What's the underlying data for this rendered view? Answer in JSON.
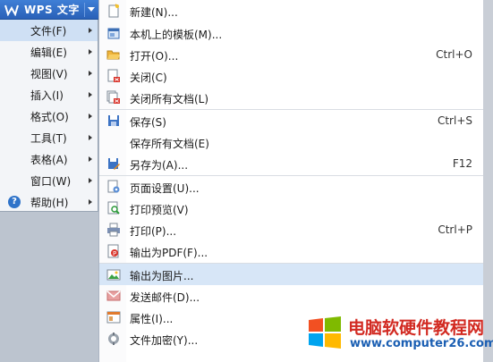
{
  "app": {
    "title": "WPS 文字"
  },
  "main_menu": {
    "items": [
      {
        "label": "文件(F)",
        "has_arrow": true
      },
      {
        "label": "编辑(E)",
        "has_arrow": true
      },
      {
        "label": "视图(V)",
        "has_arrow": true
      },
      {
        "label": "插入(I)",
        "has_arrow": true
      },
      {
        "label": "格式(O)",
        "has_arrow": true
      },
      {
        "label": "工具(T)",
        "has_arrow": true
      },
      {
        "label": "表格(A)",
        "has_arrow": true
      },
      {
        "label": "窗口(W)",
        "has_arrow": true
      },
      {
        "label": "帮助(H)",
        "has_arrow": true,
        "icon": "help-icon"
      }
    ]
  },
  "file_menu": {
    "items": [
      {
        "label": "新建(N)...",
        "icon": "new-document-icon",
        "shortcut": ""
      },
      {
        "label": "本机上的模板(M)...",
        "icon": "template-icon",
        "shortcut": ""
      },
      {
        "label": "打开(O)...",
        "icon": "open-folder-icon",
        "shortcut": "Ctrl+O"
      },
      {
        "label": "关闭(C)",
        "icon": "close-document-icon",
        "shortcut": ""
      },
      {
        "label": "关闭所有文档(L)",
        "icon": "close-all-icon",
        "shortcut": ""
      },
      {
        "label": "保存(S)",
        "icon": "save-icon",
        "shortcut": "Ctrl+S"
      },
      {
        "label": "保存所有文档(E)",
        "icon": "",
        "shortcut": ""
      },
      {
        "label": "另存为(A)...",
        "icon": "save-as-icon",
        "shortcut": "F12"
      },
      {
        "label": "页面设置(U)...",
        "icon": "page-setup-icon",
        "shortcut": ""
      },
      {
        "label": "打印预览(V)",
        "icon": "print-preview-icon",
        "shortcut": ""
      },
      {
        "label": "打印(P)...",
        "icon": "printer-icon",
        "shortcut": "Ctrl+P"
      },
      {
        "label": "输出为PDF(F)...",
        "icon": "pdf-icon",
        "shortcut": ""
      },
      {
        "label": "输出为图片...",
        "icon": "image-export-icon",
        "shortcut": ""
      },
      {
        "label": "发送邮件(D)...",
        "icon": "mail-icon",
        "shortcut": ""
      },
      {
        "label": "属性(I)...",
        "icon": "properties-icon",
        "shortcut": ""
      },
      {
        "label": "文件加密(Y)...",
        "icon": "encrypt-icon",
        "shortcut": ""
      }
    ]
  },
  "watermark": {
    "brand": "电脑软硬件教程网",
    "url": "www.computer26.com"
  },
  "colors": {
    "title_bar": "#2a61b8",
    "highlight": "#d7e6f7",
    "watermark_red": "#d22a22",
    "watermark_blue": "#1b5fb3"
  }
}
